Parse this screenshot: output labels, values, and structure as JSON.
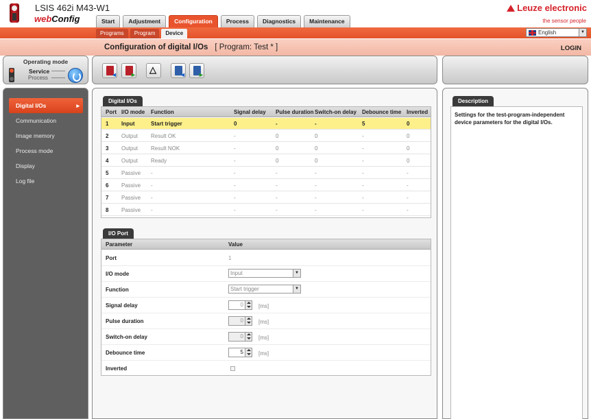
{
  "header": {
    "device": "LSIS 462i M43-W1",
    "app_web": "web",
    "app_config": "Config",
    "brand": "Leuze electronic",
    "tagline": "the sensor people"
  },
  "main_tabs": [
    "Start",
    "Adjustment",
    "Configuration",
    "Process",
    "Diagnostics",
    "Maintenance"
  ],
  "sub_tabs": [
    "Programs",
    "Program",
    "Device"
  ],
  "language": "English",
  "page": {
    "title": "Configuration of digital I/Os",
    "program": "[ Program: Test * ]",
    "login": "LOGIN"
  },
  "operating_mode": {
    "title": "Operating mode",
    "service": "Service",
    "process": "Process"
  },
  "nav": [
    "Digital I/Os",
    "Communication",
    "Image memory",
    "Process mode",
    "Display",
    "Log file"
  ],
  "digital_ios": {
    "tab": "Digital I/Os",
    "headers": [
      "Port",
      "I/O mode",
      "Function",
      "Signal delay",
      "Pulse duration",
      "Switch-on delay",
      "Debounce time",
      "Inverted"
    ],
    "rows": [
      [
        "1",
        "Input",
        "Start trigger",
        "0",
        "-",
        "-",
        "5",
        "0"
      ],
      [
        "2",
        "Output",
        "Result OK",
        "-",
        "0",
        "0",
        "-",
        "0"
      ],
      [
        "3",
        "Output",
        "Result NOK",
        "-",
        "0",
        "0",
        "-",
        "0"
      ],
      [
        "4",
        "Output",
        "Ready",
        "-",
        "0",
        "0",
        "-",
        "0"
      ],
      [
        "5",
        "Passive",
        "-",
        "-",
        "-",
        "-",
        "-",
        "-"
      ],
      [
        "6",
        "Passive",
        "-",
        "-",
        "-",
        "-",
        "-",
        "-"
      ],
      [
        "7",
        "Passive",
        "-",
        "-",
        "-",
        "-",
        "-",
        "-"
      ],
      [
        "8",
        "Passive",
        "-",
        "-",
        "-",
        "-",
        "-",
        "-"
      ]
    ]
  },
  "io_port": {
    "tab": "I/O Port",
    "header_param": "Parameter",
    "header_value": "Value",
    "port_label": "Port",
    "port_value": "1",
    "io_mode_label": "I/O mode",
    "io_mode_value": "Input",
    "function_label": "Function",
    "function_value": "Start trigger",
    "signal_delay_label": "Signal delay",
    "signal_delay_value": "0",
    "pulse_duration_label": "Pulse duration",
    "pulse_duration_value": "0",
    "switch_on_delay_label": "Switch-on delay",
    "switch_on_delay_value": "0",
    "debounce_label": "Debounce time",
    "debounce_value": "5",
    "inverted_label": "Inverted",
    "unit": "[ms]"
  },
  "description": {
    "tab": "Description",
    "text": "Settings for the test-program-independent device parameters for the digital I/Os."
  },
  "colors": {
    "accent": "#e9542d",
    "highlight_row": "#fdf08a",
    "brand": "#d4222a"
  }
}
